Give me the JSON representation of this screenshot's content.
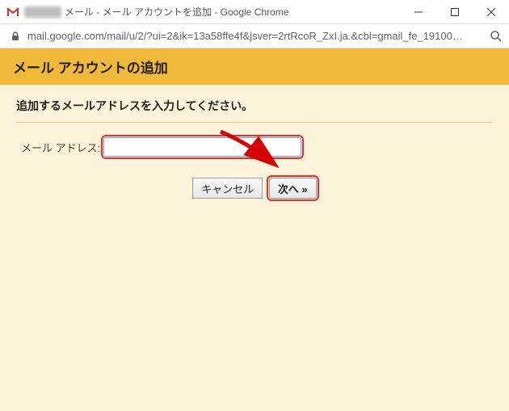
{
  "window": {
    "title_suffix": " メール - メール アカウントを追加 - Google Chrome"
  },
  "urlbar": {
    "url": "mail.google.com/mail/u/2/?ui=2&ik=13a58ffe4f&jsver=2rtRcoR_ZxI.ja.&cbl=gmail_fe_19100…"
  },
  "page": {
    "banner_title": "メール アカウントの追加",
    "instruction": "追加するメールアドレスを入力してください。",
    "form": {
      "email_label": "メール アドレス:",
      "email_value": ""
    },
    "buttons": {
      "cancel": "キャンセル",
      "next": "次へ »"
    }
  }
}
